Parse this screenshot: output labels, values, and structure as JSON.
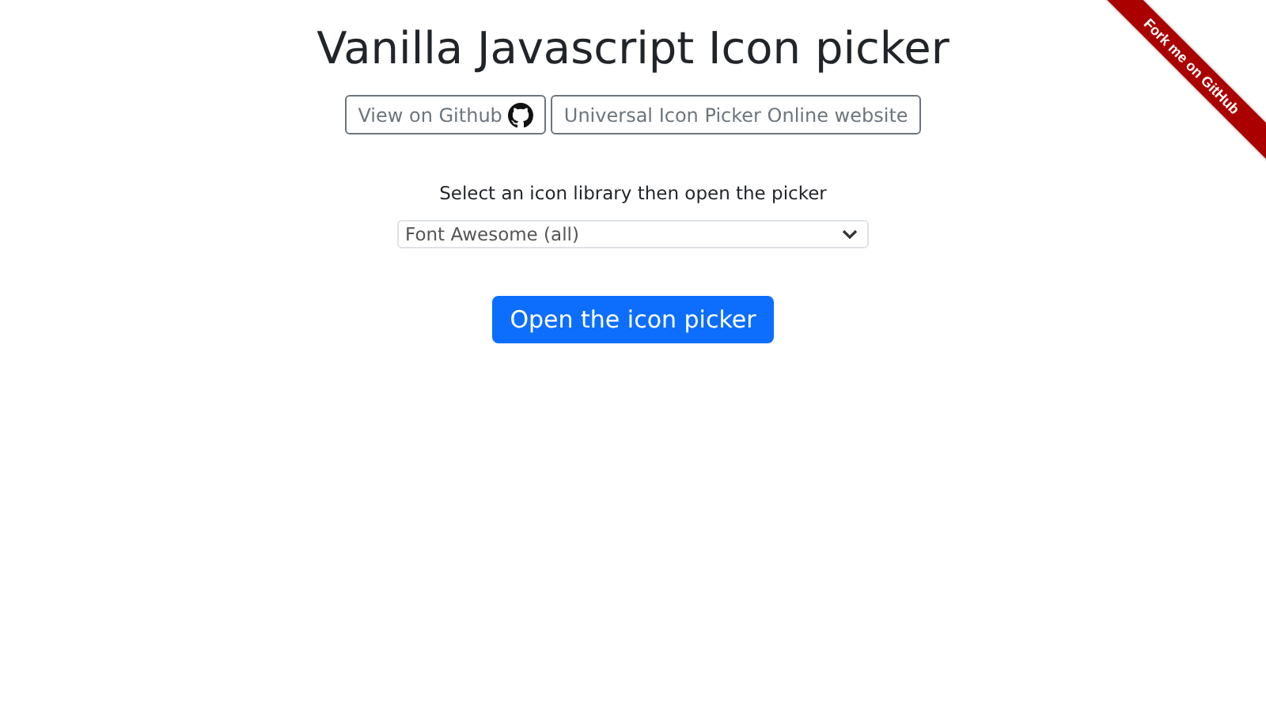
{
  "title": "Vanilla Javascript Icon picker",
  "links": [
    {
      "label": "View on Github",
      "kind": "github"
    },
    {
      "label": "Universal Icon Picker Online website",
      "kind": "plain"
    }
  ],
  "prompt": "Select an icon library then open the picker",
  "library_select": {
    "value": "Font Awesome (all)"
  },
  "open_button": "Open the icon picker",
  "ribbon": "Fork me on GitHub"
}
